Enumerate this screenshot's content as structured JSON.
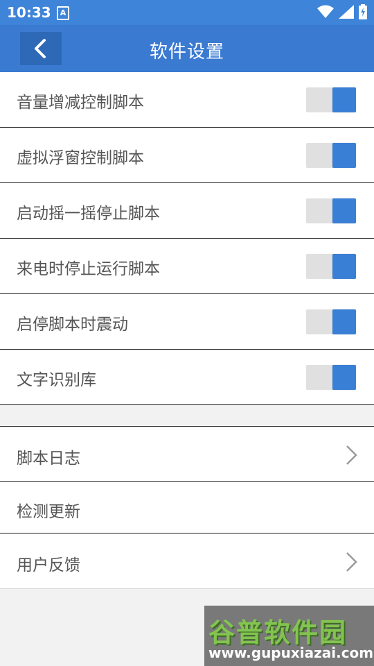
{
  "status_bar": {
    "time": "10:33",
    "app_badge": "A",
    "icons": [
      "wifi-icon",
      "signal-icon",
      "battery-icon"
    ]
  },
  "app_bar": {
    "title": "软件设置",
    "back_icon": "chevron-left-icon"
  },
  "toggle_settings": [
    {
      "label": "音量增减控制脚本",
      "enabled": true
    },
    {
      "label": "虚拟浮窗控制脚本",
      "enabled": true
    },
    {
      "label": "启动摇一摇停止脚本",
      "enabled": true
    },
    {
      "label": "来电时停止运行脚本",
      "enabled": true
    },
    {
      "label": "启停脚本时震动",
      "enabled": true
    },
    {
      "label": "文字识别库",
      "enabled": true
    }
  ],
  "menu_items": [
    {
      "label": "脚本日志",
      "has_chevron": true
    },
    {
      "label": "检测更新",
      "has_chevron": false
    },
    {
      "label": "用户反馈",
      "has_chevron": true
    }
  ],
  "watermark": {
    "title": "谷普软件园",
    "url": "www.gupuxiazai.com"
  },
  "colors": {
    "primary": "#3b7ad1",
    "status_bar": "#3e84d9",
    "toggle_on": "#3a7fd6",
    "toggle_track": "#e0e0e0",
    "text": "#555555"
  }
}
